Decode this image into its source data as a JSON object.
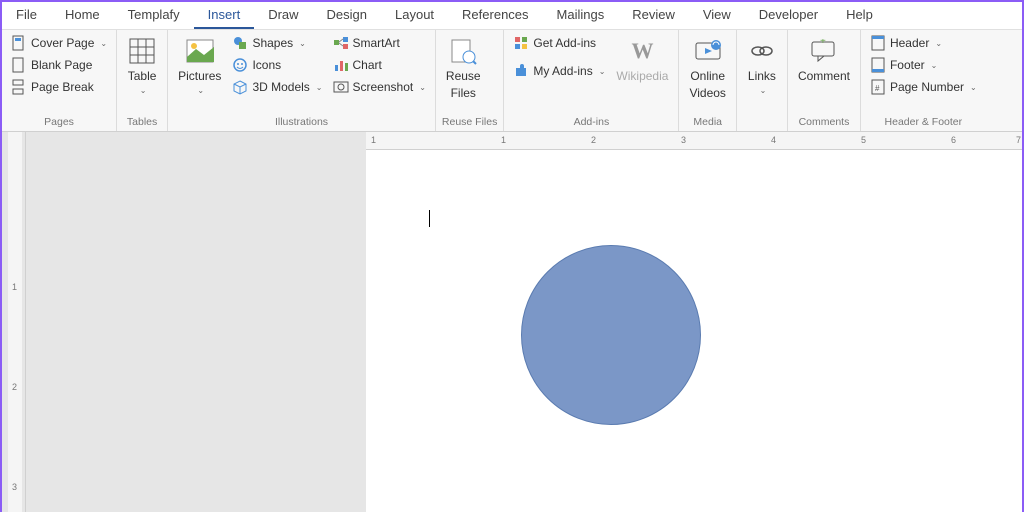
{
  "tabs": [
    "File",
    "Home",
    "Templafy",
    "Insert",
    "Draw",
    "Design",
    "Layout",
    "References",
    "Mailings",
    "Review",
    "View",
    "Developer",
    "Help"
  ],
  "active_tab": 3,
  "ribbon": {
    "pages": {
      "label": "Pages",
      "cover_page": "Cover Page",
      "blank_page": "Blank Page",
      "page_break": "Page Break"
    },
    "tables": {
      "label": "Tables",
      "table": "Table"
    },
    "illustrations": {
      "label": "Illustrations",
      "pictures": "Pictures",
      "shapes": "Shapes",
      "icons": "Icons",
      "models": "3D Models",
      "smart_art": "SmartArt",
      "chart": "Chart",
      "screenshot": "Screenshot"
    },
    "reuse": {
      "label": "Reuse Files",
      "reuse_files": "Reuse",
      "reuse_files2": "Files"
    },
    "addins": {
      "label": "Add-ins",
      "get": "Get Add-ins",
      "my": "My Add-ins",
      "wikipedia": "Wikipedia"
    },
    "media": {
      "label": "Media",
      "online": "Online",
      "videos": "Videos"
    },
    "links": {
      "label": "",
      "links": "Links"
    },
    "comments": {
      "label": "Comments",
      "comment": "Comment"
    },
    "header_footer": {
      "label": "Header & Footer",
      "header": "Header",
      "footer": "Footer",
      "page_number": "Page Number"
    }
  },
  "ruler_h": [
    "1",
    "1",
    "2",
    "3",
    "4",
    "5",
    "6",
    "7"
  ],
  "ruler_v": [
    "1",
    "2",
    "3"
  ]
}
